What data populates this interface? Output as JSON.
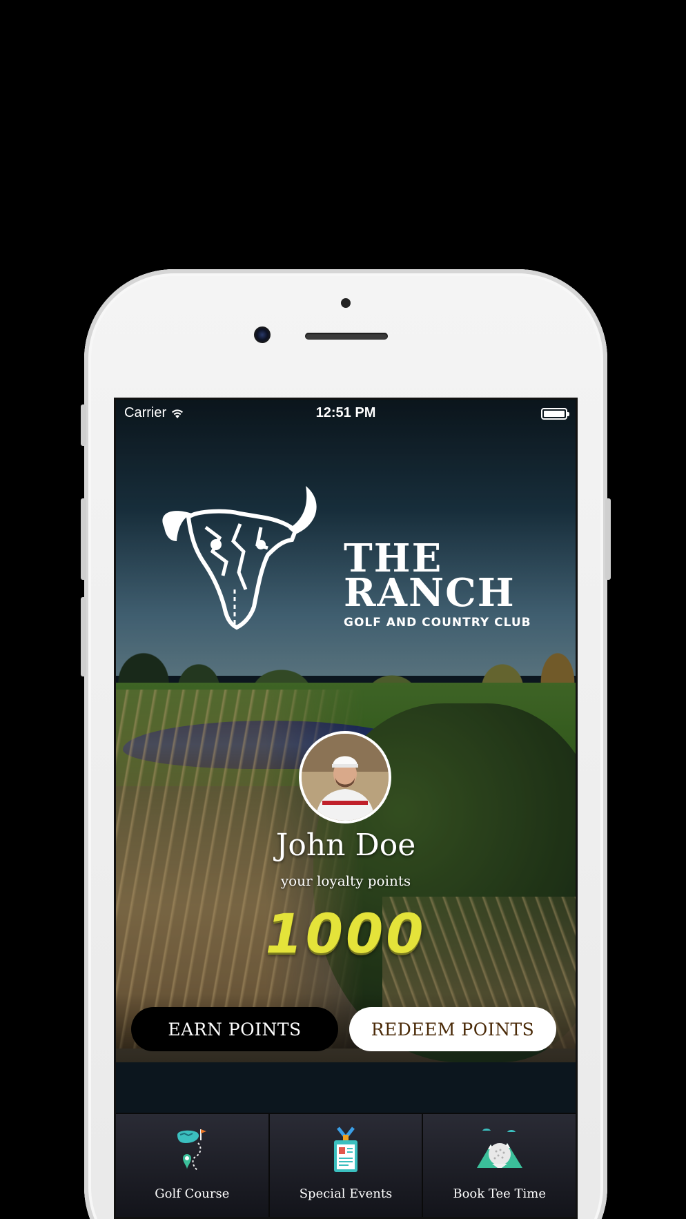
{
  "status_bar": {
    "carrier": "Carrier",
    "time": "12:51 PM"
  },
  "logo": {
    "line1": "THE",
    "line2": "RANCH",
    "line3": "GOLF AND COUNTRY CLUB"
  },
  "profile": {
    "name": "John Doe",
    "points_label": "your loyalty points",
    "points": "1000"
  },
  "actions": {
    "earn_label": "EARN POINTS",
    "redeem_label": "REDEEM POINTS"
  },
  "bottom_nav": {
    "items": [
      {
        "label": "Golf Course",
        "icon": "golf-course-map-icon"
      },
      {
        "label": "Special Events",
        "icon": "event-badge-icon"
      },
      {
        "label": "Book Tee Time",
        "icon": "golf-ball-tee-icon"
      }
    ]
  },
  "colors": {
    "points_yellow": "#e4e33a",
    "redeem_text_brown": "#4a2a08",
    "nav_icon_teal": "#3bbfbf"
  }
}
